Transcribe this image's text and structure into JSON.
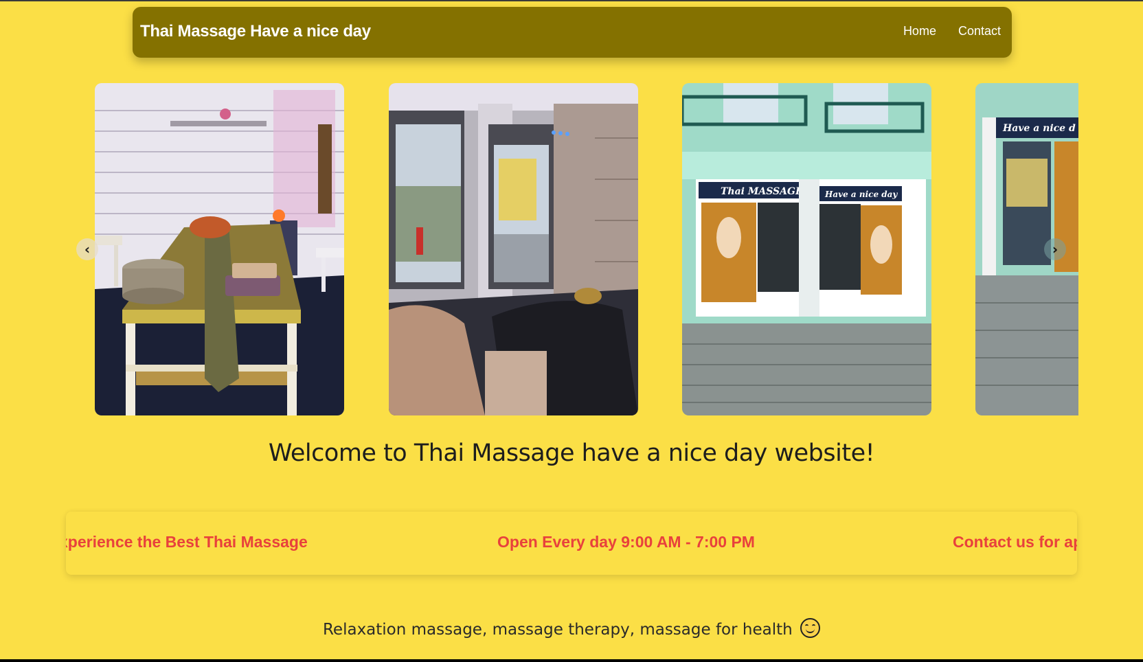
{
  "navbar": {
    "brand": "Thai Massage Have a nice day",
    "links": [
      "Home",
      "Contact"
    ]
  },
  "carousel": {
    "slides": [
      {
        "name": "massage-room-photo"
      },
      {
        "name": "lounge-window-photo"
      },
      {
        "name": "shop-front-photo",
        "signs": [
          "Thai MASSAGE",
          "Have a nice day"
        ]
      },
      {
        "name": "shop-window-photo",
        "signs": [
          "Have a nice d"
        ]
      }
    ],
    "prev_icon": "chevron-left-icon",
    "next_icon": "chevron-right-icon"
  },
  "welcome": "Welcome to Thai Massage have a nice day website!",
  "ticker": {
    "items": [
      "xperience the Best Thai Massage",
      "Open Every day 9:00 AM - 7:00 PM",
      "Contact us for ap"
    ],
    "color": "#e8413c"
  },
  "tagline": "Relaxation massage, massage therapy, massage for health",
  "tagline_icon": "smiling-face-icon",
  "colors": {
    "background": "#fbdf46",
    "navbar": "#847100",
    "ticker_text": "#e8413c"
  }
}
